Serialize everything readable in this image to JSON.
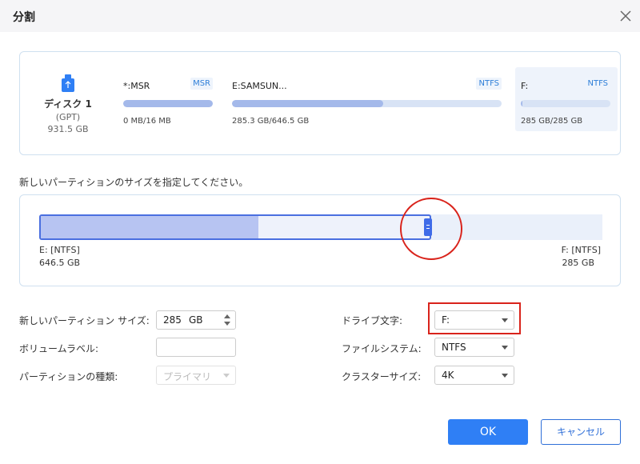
{
  "dialog": {
    "title": "分割"
  },
  "disk": {
    "name": "ディスク 1",
    "type": "(GPT)",
    "size": "931.5 GB"
  },
  "partitions": [
    {
      "name": "*:MSR",
      "fs": "MSR",
      "size": "0 MB/16 MB",
      "used_fraction": 1.0
    },
    {
      "name": "E:SAMSUN...",
      "fs": "NTFS",
      "size": "285.3 GB/646.5 GB",
      "used_fraction": 0.56
    },
    {
      "name": "F:",
      "fs": "NTFS",
      "size": "285 GB/285 GB",
      "used_fraction": 0.02
    }
  ],
  "instruction": "新しいパーティションのサイズを指定してください。",
  "resize": {
    "left_name": "E: [NTFS]",
    "left_size": "646.5 GB",
    "right_name": "F: [NTFS]",
    "right_size": "285 GB",
    "left_used_fraction": 0.56,
    "split_fraction": 0.69
  },
  "form": {
    "size_label": "新しいパーティション サイズ:",
    "size_value": "285",
    "size_unit": "GB",
    "volume_label": "ボリュームラベル:",
    "volume_value": "",
    "type_label": "パーティションの種類:",
    "type_value": "プライマリ",
    "drive_label": "ドライブ文字:",
    "drive_value": "F:",
    "fs_label": "ファイルシステム:",
    "fs_value": "NTFS",
    "cluster_label": "クラスターサイズ:",
    "cluster_value": "4K"
  },
  "buttons": {
    "ok": "OK",
    "cancel": "キャンセル"
  },
  "colors": {
    "accent": "#2f7ff5",
    "annotation": "#d9231b",
    "bar_used": "#a4b9ea"
  }
}
